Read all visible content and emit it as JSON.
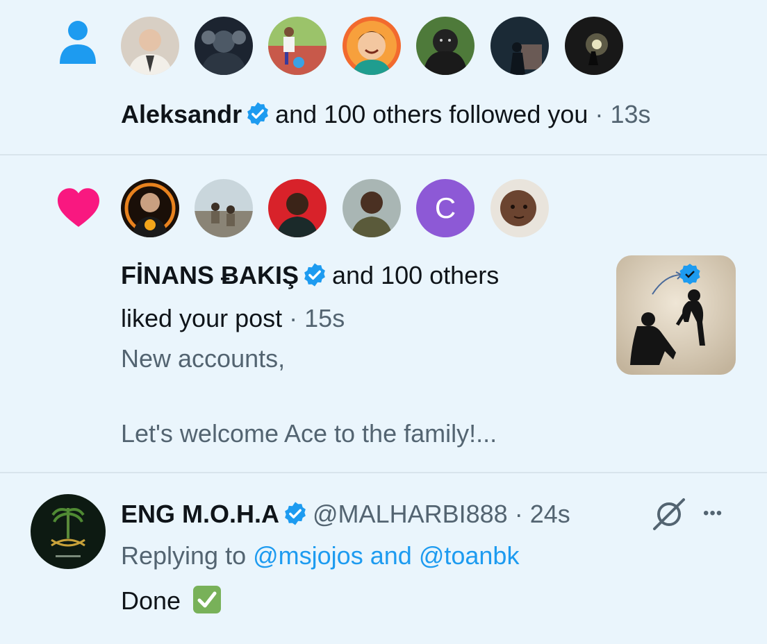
{
  "follow": {
    "user_name": "Aleksandr",
    "text": "and 100 others followed you",
    "separator": "·",
    "time": "13s",
    "avatar_initial": ""
  },
  "like": {
    "user_name": "FİNANS ɃAKIŞ",
    "text1": "and 100 others",
    "text2": "liked your post",
    "separator": "·",
    "time": "15s",
    "snippet1": "New accounts,",
    "snippet2": "Let's welcome Ace to the family!...",
    "letter_avatar": "C"
  },
  "reply": {
    "display_name": "ENG M.O.H.A",
    "handle": "@MALHARBI888",
    "separator": "·",
    "time": "24s",
    "replying_prefix": "Replying to",
    "mention1": "@msjojos",
    "and_word": "and",
    "mention2": "@toanbk",
    "body": "Done",
    "more": "•••"
  },
  "colors": {
    "background": "#eaf5fc",
    "accent_blue": "#1d9bf0",
    "heart_pink": "#f91880",
    "verified": "#1d9bf0",
    "checkmark_green": "#78b159"
  }
}
